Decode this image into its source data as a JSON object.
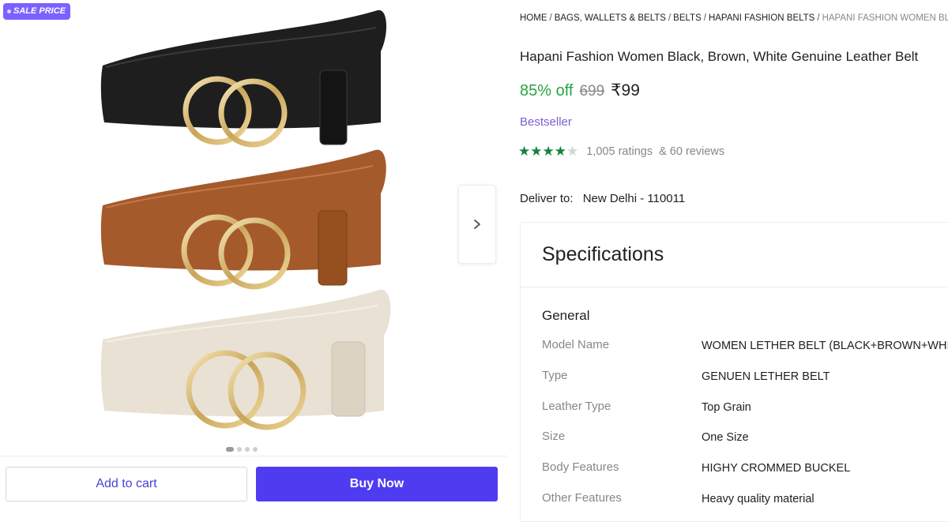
{
  "badge": {
    "label": "SALE PRICE"
  },
  "gallery": {
    "image_alt": "Three leather belts in black, brown and white with gold double-ring buckles",
    "slide_count": 4,
    "active_slide": 1
  },
  "actions": {
    "add_to_cart": "Add to cart",
    "buy_now": "Buy Now"
  },
  "breadcrumb": [
    "HOME",
    "BAGS, WALLETS & BELTS",
    "BELTS",
    "HAPANI FASHION BELTS",
    "HAPANI FASHION WOMEN BLACK, BROWN, WHITE GENUINE LEATHER BELT"
  ],
  "product": {
    "title": "Hapani Fashion Women Black, Brown, White Genuine Leather Belt",
    "discount": "85% off",
    "mrp": "699",
    "price": "₹99",
    "tag": "Bestseller",
    "rating_stars": 4,
    "ratings_text": "1,005 ratings",
    "reviews_text": "& 60 reviews"
  },
  "delivery": {
    "label": "Deliver to:",
    "location": "New Delhi - 110011"
  },
  "specifications": {
    "heading": "Specifications",
    "group": "General",
    "rows": [
      {
        "key": "Model Name",
        "value": "WOMEN LETHER BELT (BLACK+BROWN+WHITE)"
      },
      {
        "key": "Type",
        "value": "GENUEN LETHER BELT"
      },
      {
        "key": "Leather Type",
        "value": "Top Grain"
      },
      {
        "key": "Size",
        "value": "One Size"
      },
      {
        "key": "Body Features",
        "value": "HIGHY CROMMED BUCKEL"
      },
      {
        "key": "Other Features",
        "value": "Heavy quality material"
      }
    ]
  },
  "colors": {
    "accent": "#4f3cf0",
    "discount": "#26a541",
    "star": "#13823b",
    "badge": "#7b61ff"
  },
  "icons": {
    "next": "chevron-right-icon",
    "star_filled": "star-filled-icon",
    "star_empty": "star-empty-icon"
  }
}
